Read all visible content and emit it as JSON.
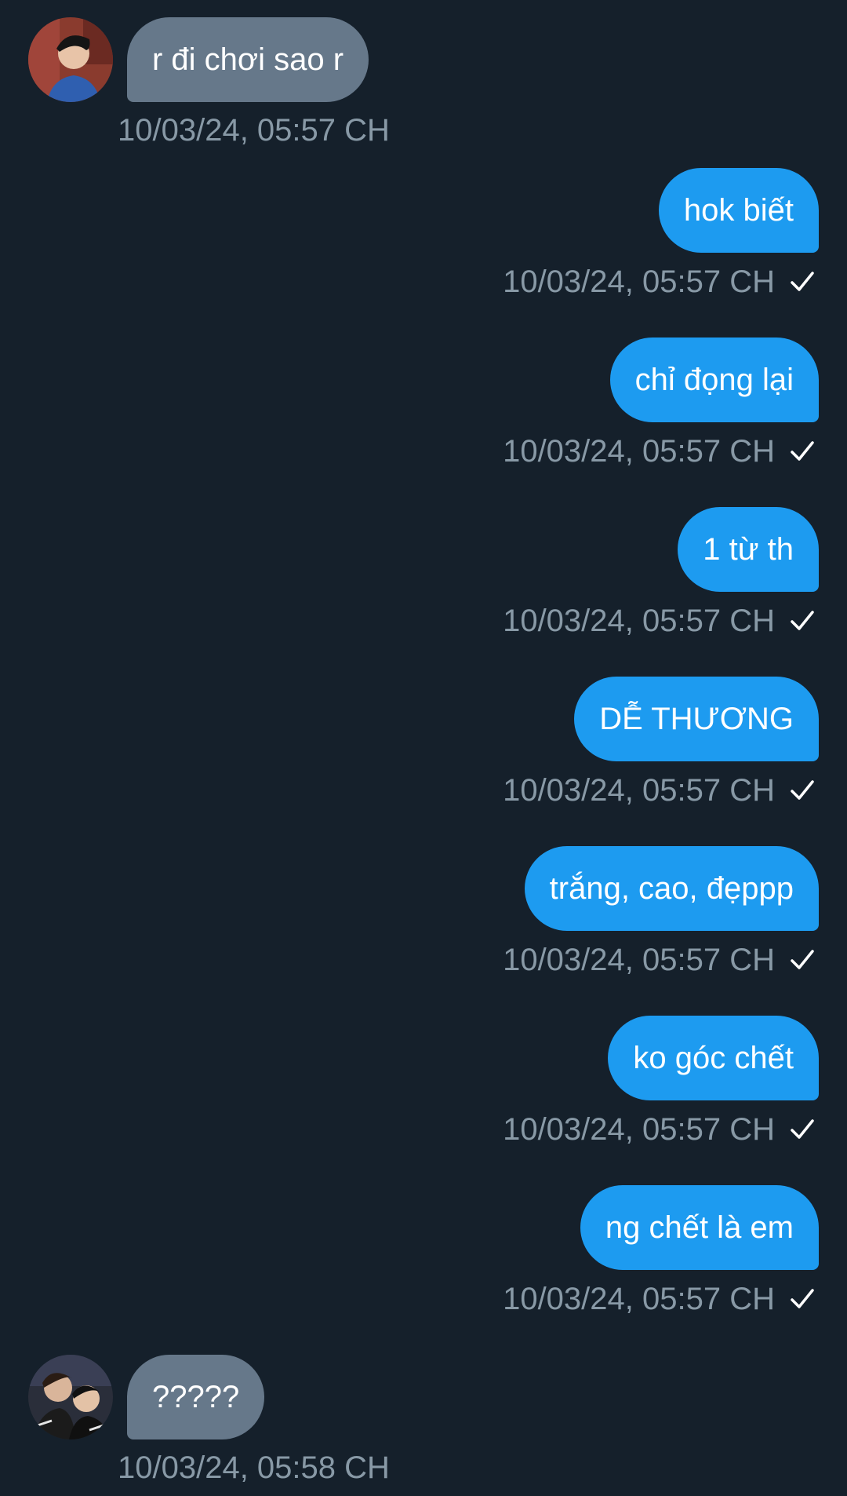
{
  "colors": {
    "background": "#15202b",
    "incoming_bubble": "#66788a",
    "outgoing_bubble": "#1d9bf0",
    "timestamp": "#8899a6",
    "text": "#ffffff"
  },
  "messages": [
    {
      "direction": "in",
      "avatar": "avatar-photo-1",
      "text": "r đi chơi sao r",
      "timestamp": "10/03/24, 05:57 CH"
    },
    {
      "direction": "out",
      "text": "hok biết",
      "timestamp": "10/03/24, 05:57 CH",
      "status_icon": "check-icon"
    },
    {
      "direction": "out",
      "text": "chỉ đọng lại",
      "timestamp": "10/03/24, 05:57 CH",
      "status_icon": "check-icon"
    },
    {
      "direction": "out",
      "text": "1 từ th",
      "timestamp": "10/03/24, 05:57 CH",
      "status_icon": "check-icon"
    },
    {
      "direction": "out",
      "text": "DỄ THƯƠNG",
      "timestamp": "10/03/24, 05:57 CH",
      "status_icon": "check-icon"
    },
    {
      "direction": "out",
      "text": "trắng, cao, đẹppp",
      "timestamp": "10/03/24, 05:57 CH",
      "status_icon": "check-icon"
    },
    {
      "direction": "out",
      "text": "ko góc chết",
      "timestamp": "10/03/24, 05:57 CH",
      "status_icon": "check-icon"
    },
    {
      "direction": "out",
      "text": "ng chết là em",
      "timestamp": "10/03/24, 05:57 CH",
      "status_icon": "check-icon"
    },
    {
      "direction": "in",
      "avatar": "avatar-photo-2",
      "text": "?????",
      "timestamp": "10/03/24, 05:58 CH"
    }
  ]
}
